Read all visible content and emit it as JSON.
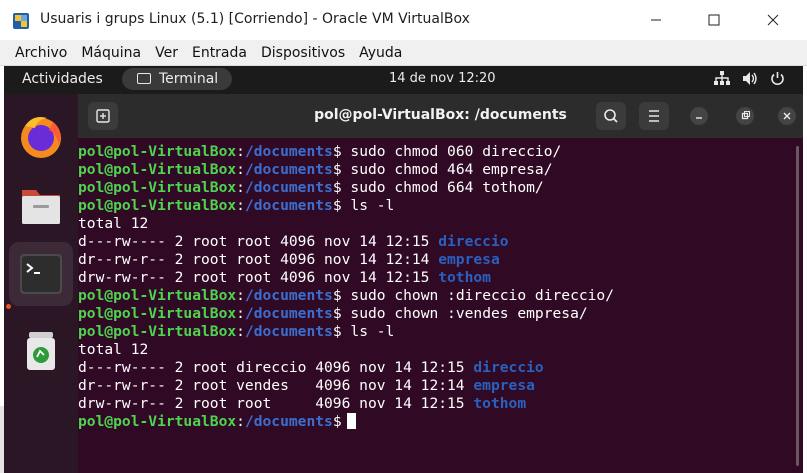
{
  "window": {
    "title": "Usuaris i grups Linux (5.1) [Corriendo] - Oracle VM VirtualBox"
  },
  "menu": [
    "Archivo",
    "Máquina",
    "Ver",
    "Entrada",
    "Dispositivos",
    "Ayuda"
  ],
  "topbar": {
    "activities": "Actividades",
    "app_label": "Terminal",
    "clock": "14 de nov  12:20"
  },
  "terminal": {
    "title": "pol@pol-VirtualBox: /documents",
    "lines": [
      {
        "kind": "prompt",
        "user": "pol@pol-VirtualBox",
        "path": "/documents",
        "cmd": " sudo chmod 060 direccio/"
      },
      {
        "kind": "prompt",
        "user": "pol@pol-VirtualBox",
        "path": "/documents",
        "cmd": " sudo chmod 464 empresa/"
      },
      {
        "kind": "prompt",
        "user": "pol@pol-VirtualBox",
        "path": "/documents",
        "cmd": " sudo chmod 664 tothom/"
      },
      {
        "kind": "prompt",
        "user": "pol@pol-VirtualBox",
        "path": "/documents",
        "cmd": " ls -l"
      },
      {
        "kind": "text",
        "text": "total 12"
      },
      {
        "kind": "entry",
        "pre": "d---rw---- 2 root root 4096 nov 14 12:15 ",
        "name": "direccio"
      },
      {
        "kind": "entry",
        "pre": "dr--rw-r-- 2 root root 4096 nov 14 12:14 ",
        "name": "empresa"
      },
      {
        "kind": "entry",
        "pre": "drw-rw-r-- 2 root root 4096 nov 14 12:15 ",
        "name": "tothom"
      },
      {
        "kind": "prompt",
        "user": "pol@pol-VirtualBox",
        "path": "/documents",
        "cmd": " sudo chown :direccio direccio/"
      },
      {
        "kind": "prompt",
        "user": "pol@pol-VirtualBox",
        "path": "/documents",
        "cmd": " sudo chown :vendes empresa/"
      },
      {
        "kind": "prompt",
        "user": "pol@pol-VirtualBox",
        "path": "/documents",
        "cmd": " ls -l"
      },
      {
        "kind": "text",
        "text": "total 12"
      },
      {
        "kind": "entry",
        "pre": "d---rw---- 2 root direccio 4096 nov 14 12:15 ",
        "name": "direccio"
      },
      {
        "kind": "entry",
        "pre": "dr--rw-r-- 2 root vendes   4096 nov 14 12:14 ",
        "name": "empresa"
      },
      {
        "kind": "entry",
        "pre": "drw-rw-r-- 2 root root     4096 nov 14 12:15 ",
        "name": "tothom"
      },
      {
        "kind": "prompt",
        "user": "pol@pol-VirtualBox",
        "path": "/documents",
        "cmd": "",
        "cursor": true
      }
    ]
  },
  "dock": [
    "firefox-icon",
    "files-icon",
    "terminal-icon",
    "trash-icon"
  ],
  "colors": {
    "terminal_bg": "#300a24",
    "prompt_user": "#4fd44f",
    "prompt_path": "#3b6ed0",
    "dir_name": "#2a60bf",
    "accent": "#e95420"
  }
}
